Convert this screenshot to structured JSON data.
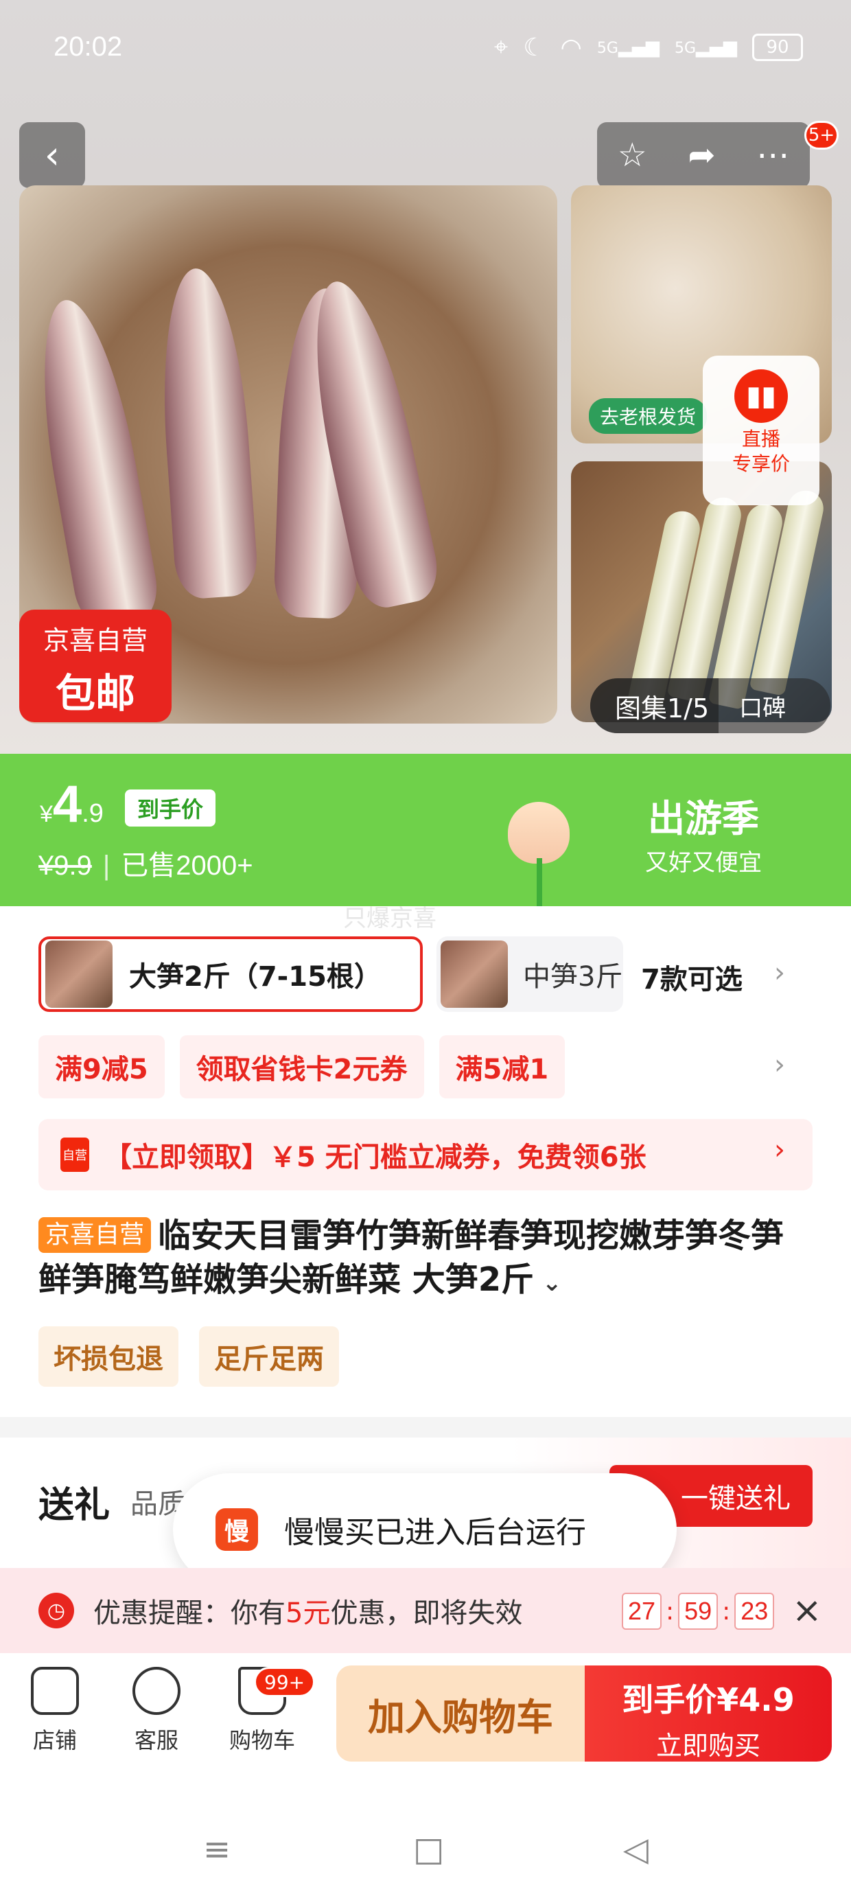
{
  "status_bar": {
    "time": "20:02",
    "battery": "90",
    "signal_1": "5G",
    "signal_2": "5G"
  },
  "header": {
    "back_icon": "chevron-left-icon",
    "more_badge": "5+"
  },
  "gallery": {
    "store_tag_line1": "京喜自营",
    "store_tag_line2": "包邮",
    "side_tag": "去老根发货",
    "live_line1": "直播",
    "live_line2": "专享价",
    "gallery_label": "图集1/5",
    "reviews_label": "口碑"
  },
  "price": {
    "currency": "¥",
    "integer": "4",
    "decimal": ".9",
    "hand_price_tag": "到手价",
    "original": "¥9.9",
    "sold": "已售2000+",
    "season_title": "出游季",
    "season_sub": "又好又便宜",
    "watermark": "只爆京喜"
  },
  "sku": {
    "selected": "大笋2斤（7-15根）",
    "other": "中笋3斤",
    "more": "7款可选"
  },
  "coupons": [
    "满9减5",
    "领取省钱卡2元券",
    "满5减1"
  ],
  "coupon_banner": {
    "icon_text": "自营",
    "text": "【立即领取】￥5 无门槛立减券，免费领6张"
  },
  "product": {
    "store_tag": "京喜自营",
    "title": "临安天目雷笋竹笋新鲜春笋现挖嫩芽笋冬笋鲜笋腌笃鲜嫩笋尖新鲜菜 大笋2斤",
    "guarantees": [
      "坏损包退",
      "足斤足两"
    ]
  },
  "gift": {
    "title": "送礼",
    "subtitle": "品质",
    "button": "一键送礼"
  },
  "toast": {
    "app_icon_text": "慢",
    "text": "慢慢买已进入后台运行"
  },
  "reminder": {
    "prefix": "优惠提醒：你有",
    "amount": "5元",
    "suffix": "优惠，即将失效",
    "hh": "27",
    "mm": "59",
    "ss": "23"
  },
  "bottom": {
    "shop": "店铺",
    "service": "客服",
    "cart": "购物车",
    "cart_badge": "99+",
    "add_cart": "加入购物车",
    "buy_price": "到手价¥4.9",
    "buy_now": "立即购买"
  }
}
